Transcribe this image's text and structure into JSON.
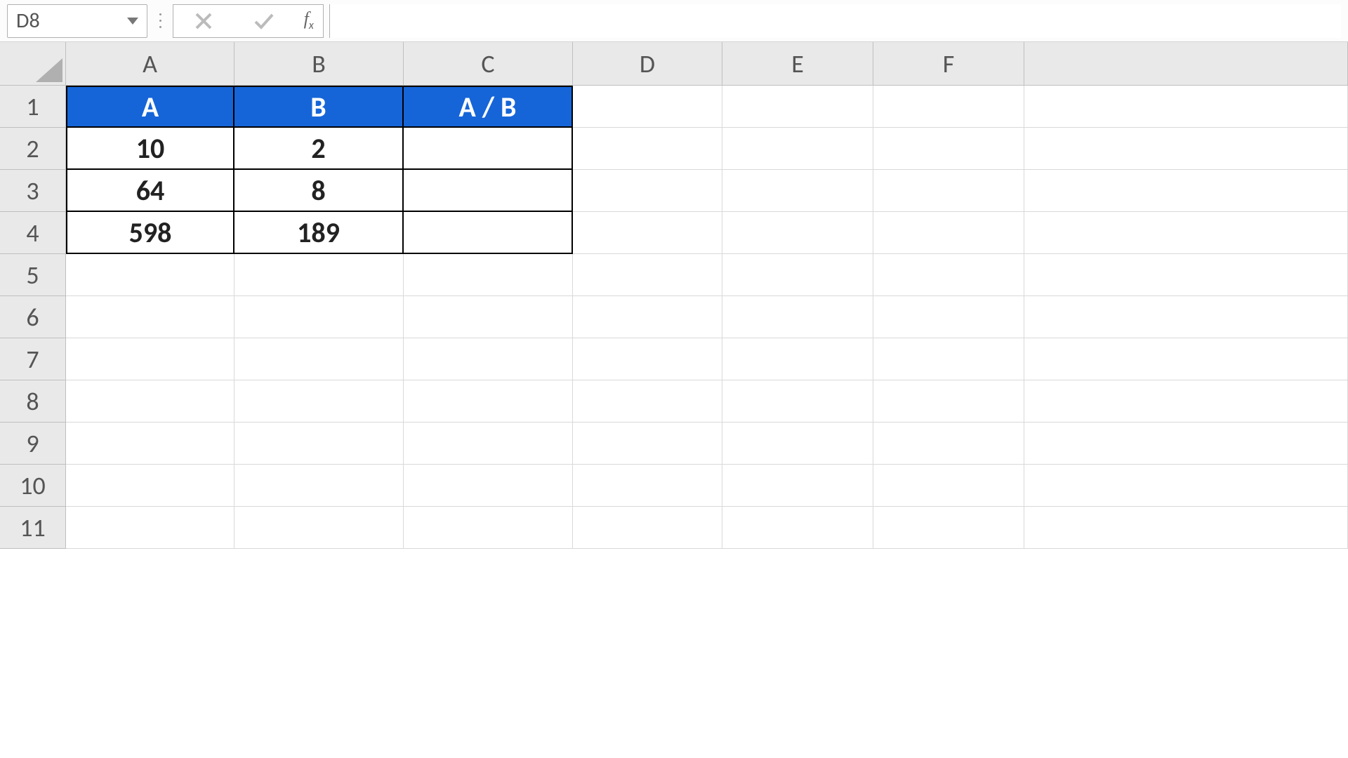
{
  "formula_bar": {
    "name_box_value": "D8",
    "cancel_symbol": "×",
    "confirm_symbol": "✓",
    "fx_label": "fₓ",
    "formula_value": ""
  },
  "columns": [
    "A",
    "B",
    "C",
    "D",
    "E",
    "F"
  ],
  "rows": [
    "1",
    "2",
    "3",
    "4",
    "5",
    "6",
    "7",
    "8",
    "9",
    "10",
    "11"
  ],
  "table": {
    "headers": {
      "A1": "A",
      "B1": "B",
      "C1": "A / B"
    },
    "data": [
      {
        "A": "10",
        "B": "2",
        "C": ""
      },
      {
        "A": "64",
        "B": "8",
        "C": ""
      },
      {
        "A": "598",
        "B": "189",
        "C": ""
      }
    ]
  },
  "colors": {
    "header_fill": "#1565d8",
    "header_text": "#ffffff"
  }
}
